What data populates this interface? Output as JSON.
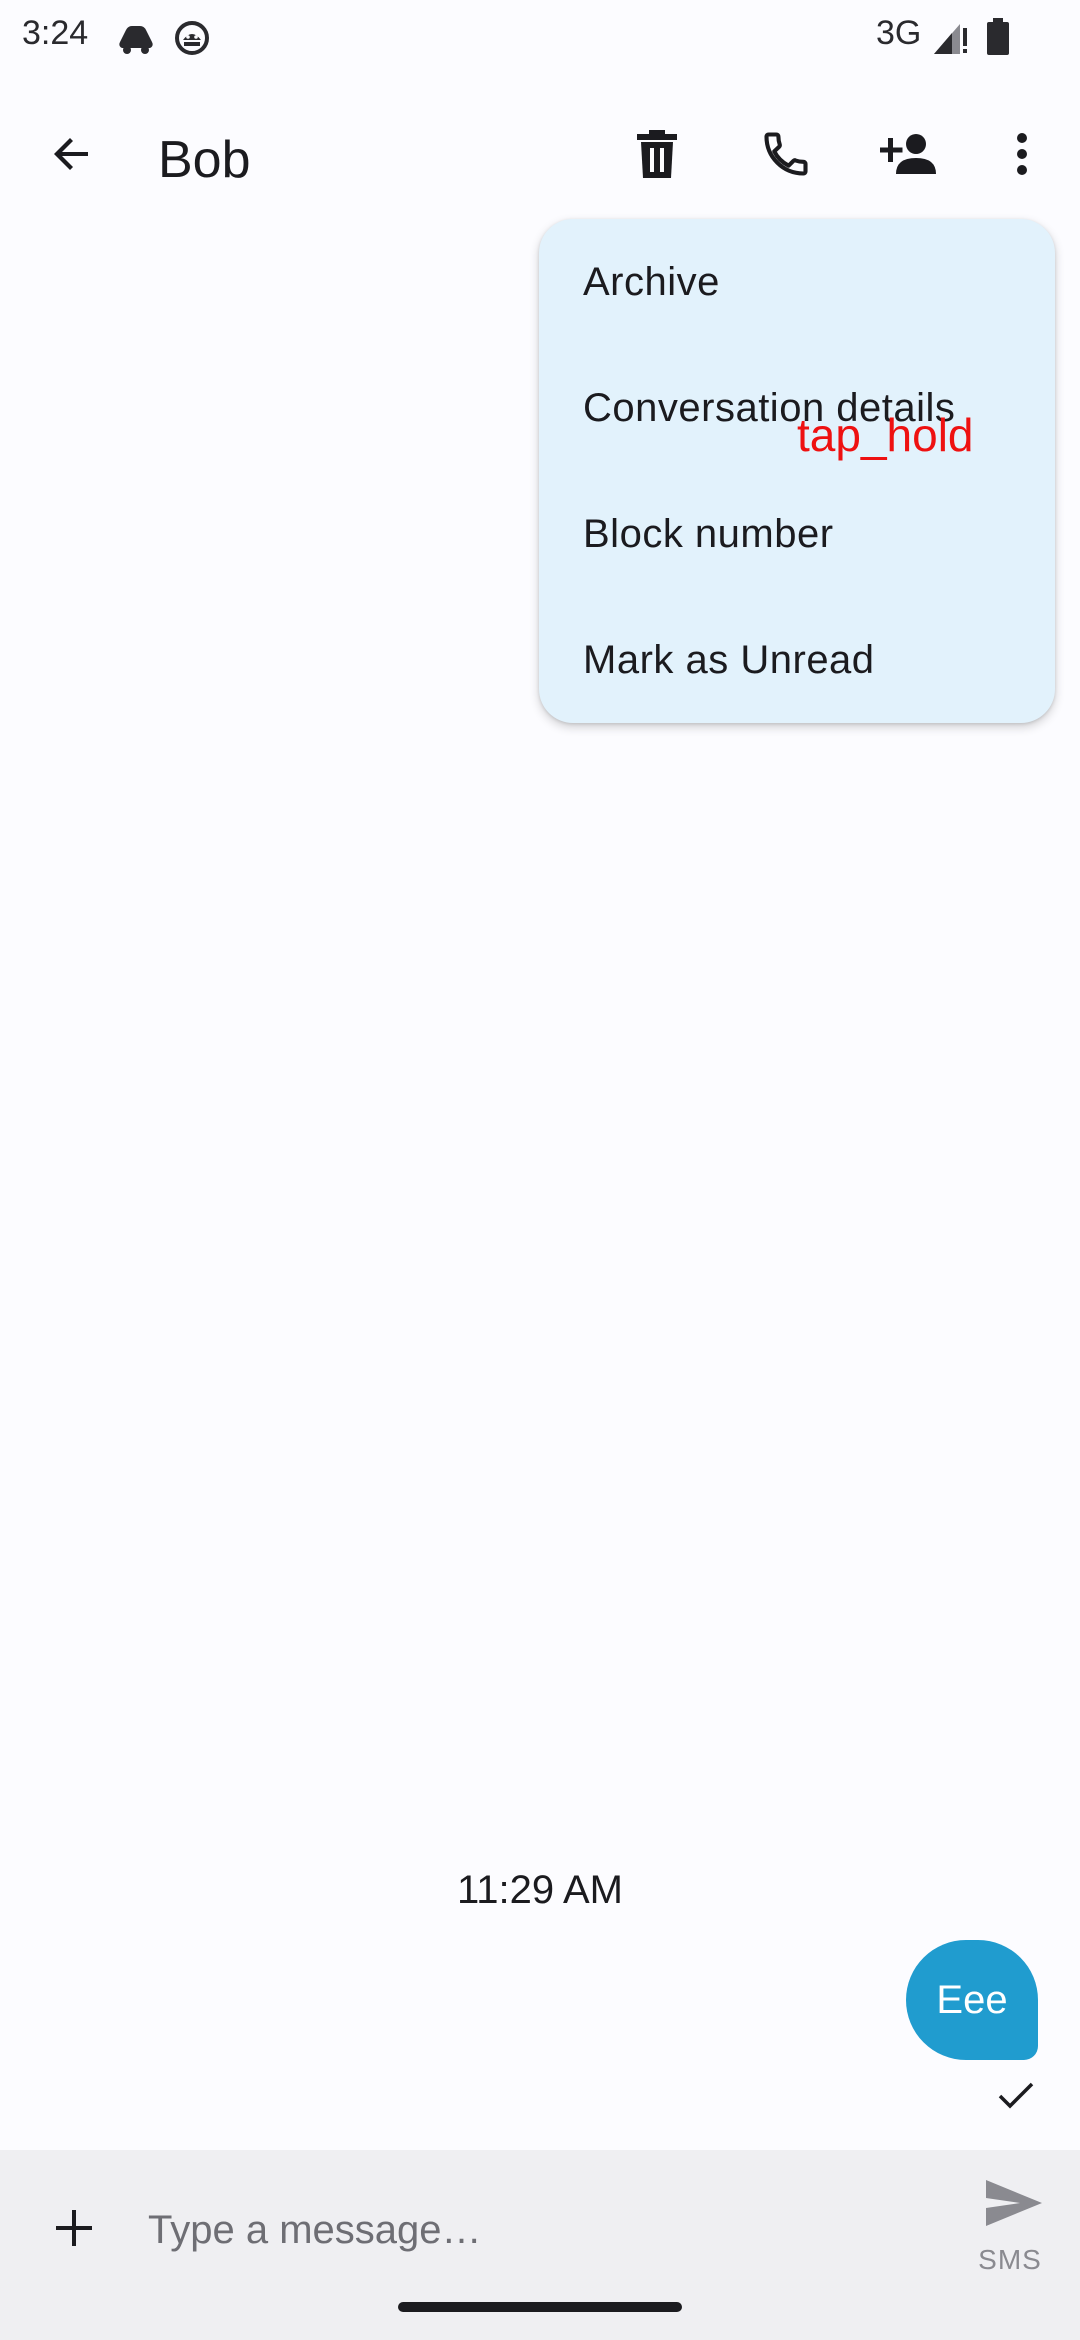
{
  "status_bar": {
    "time": "3:24",
    "network": "3G",
    "icons": [
      "notification-app-icon",
      "notification-android-icon",
      "signal-icon",
      "battery-icon"
    ]
  },
  "app_bar": {
    "contact_name": "Bob",
    "actions": [
      "back-arrow-icon",
      "delete-icon",
      "phone-icon",
      "add-contact-icon",
      "more-vert-icon"
    ]
  },
  "overflow_menu": {
    "items": [
      {
        "label": "Archive"
      },
      {
        "label": "Conversation details"
      },
      {
        "label": "Block number"
      },
      {
        "label": "Mark as Unread"
      }
    ]
  },
  "annotation": {
    "label": "tap_hold",
    "color": "#ee1111"
  },
  "conversation": {
    "timestamp": "11:29 AM",
    "messages": [
      {
        "text": "Eee",
        "direction": "outgoing",
        "status": "sent-check-icon"
      }
    ]
  },
  "compose": {
    "placeholder": "Type a message…",
    "send_label": "SMS",
    "icons": [
      "add-icon",
      "send-icon"
    ]
  },
  "colors": {
    "background": "#fcfcff",
    "menu_background": "#e2f2fc",
    "bubble": "#209ccf",
    "compose_background": "#efeff2"
  }
}
